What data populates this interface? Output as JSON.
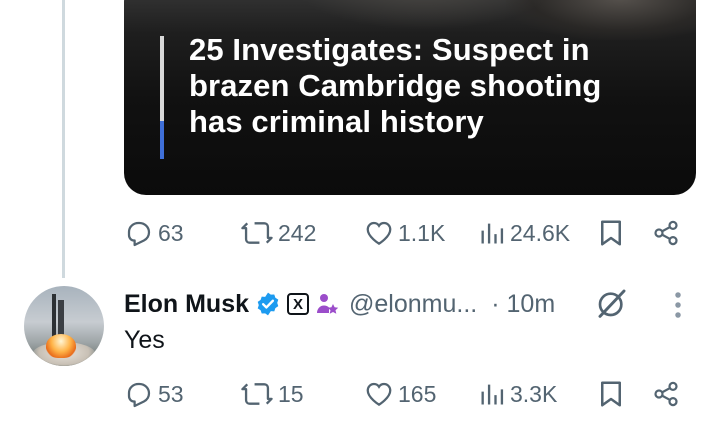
{
  "card": {
    "headline": "25 Investigates: Suspect in brazen Cambridge shooting has criminal history",
    "headline_lines": [
      "25 Investigates: Suspect in",
      "brazen Cambridge shooting",
      "has criminal history"
    ]
  },
  "post1_actions": {
    "replies": "63",
    "reposts": "242",
    "likes": "1.1K",
    "views": "24.6K"
  },
  "post2": {
    "author_name": "Elon Musk",
    "handle": "@elonmu...",
    "time": "10m",
    "text": "Yes",
    "badges": [
      "verified-badge-icon",
      "x-affiliate-badge",
      "parody-person-icon"
    ],
    "x_badge_glyph": "X"
  },
  "post2_actions": {
    "replies": "53",
    "reposts": "15",
    "likes": "165",
    "views": "3.3K"
  },
  "colors": {
    "muted": "#536471",
    "text": "#0f1419",
    "verified": "#1d9bf0",
    "accent_bar": "#3f6fd8",
    "parody_icon": "#9b4dca",
    "thread_line": "#cfd9de"
  }
}
